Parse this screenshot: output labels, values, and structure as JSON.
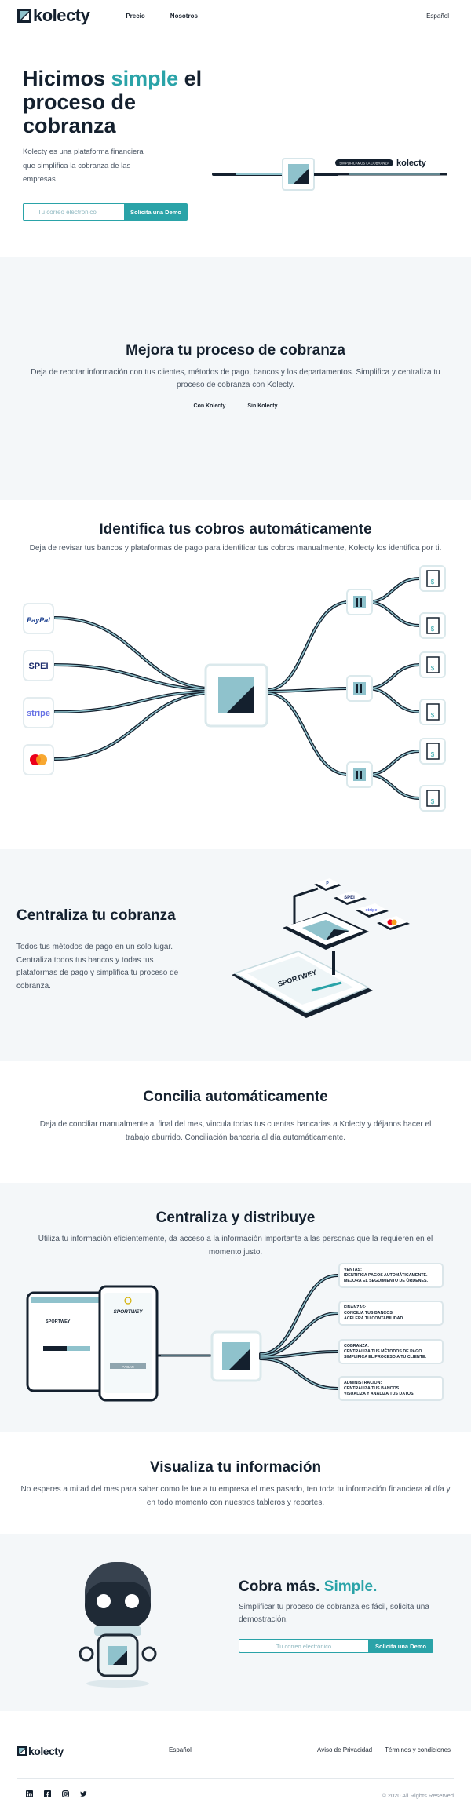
{
  "colors": {
    "accent": "#2aa3a8",
    "dark": "#14202e",
    "text": "#4a5563",
    "light_bg": "#f4f7f9"
  },
  "nav": {
    "brand": "kolecty",
    "links": [
      "Precio",
      "Nosotros"
    ],
    "language": "Español"
  },
  "hero": {
    "title_1": "Hicimos ",
    "title_accent": "simple",
    "title_2": " el proceso de cobranza",
    "description": "Kolecty es una plataforma financiera que simplifica la cobranza de las empresas.",
    "email_placeholder": "Tu correo electrónico",
    "demo_button": "Solicita una Demo",
    "badge": "SIMPLIFICAMOS LA COBRANZA",
    "badge_brand": "kolecty"
  },
  "mejora": {
    "title": "Mejora tu proceso de cobranza",
    "description": "Deja de rebotar información con tus clientes, métodos de pago, bancos y los departamentos. Simplifica y centraliza tu proceso de cobranza con Kolecty.",
    "tabs": [
      "Con Kolecty",
      "Sin Kolecty"
    ]
  },
  "identifica": {
    "title": "Identifica tus cobros automáticamente",
    "description": "Deja de revisar tus bancos y plataformas de pago para identificar tus cobros manualmente, Kolecty los identifica por ti.",
    "sources": [
      "PayPal",
      "SPEI",
      "stripe",
      "mastercard-icon"
    ]
  },
  "centraliza": {
    "title": "Centraliza tu cobranza",
    "description": "Todos tus métodos de pago en un solo lugar. Centraliza todos tus bancos y todas tus plataformas de pago y simplifica tu proceso de cobranza.",
    "phone_brand": "SPORTWEY"
  },
  "concilia": {
    "title": "Concilia automáticamente",
    "description": "Deja de conciliar manualmente al final del mes, vincula todas tus cuentas bancarias a Kolecty y déjanos hacer el trabajo aburrido. Conciliación bancaria al día automáticamente."
  },
  "distribuye": {
    "title": "Centraliza y distribuye",
    "description": "Utiliza tu información eficientemente, da acceso a la información importante a las personas que la requieren en el momento justo.",
    "laptop_brand": "SPORTWEY",
    "phone_brand": "SPORTWEY",
    "phone_button": "PAGAR",
    "cards": [
      {
        "l1": "VENTAS:",
        "l2": "IDENTIFICA PAGOS AUTOMÁTICAMENTE.",
        "l3": "MEJORA EL SEGUIMIENTO DE ÓRDENES."
      },
      {
        "l1": "FINANZAS:",
        "l2": "CONCILIA TUS BANCOS.",
        "l3": "ACELERA TU CONTABILIDAD."
      },
      {
        "l1": "COBRANZA:",
        "l2": "CENTRALIZA TUS MÉTODOS DE PAGO.",
        "l3": "SIMPLIFICA EL PROCESO A TU CLIENTE."
      },
      {
        "l1": "ADMINISTRACION:",
        "l2": "CENTRALIZA TUS BANCOS.",
        "l3": "VISUALIZA Y ANALIZA TUS DATOS."
      }
    ]
  },
  "visualiza": {
    "title": "Visualiza tu información",
    "description": "No esperes a mitad del mes para saber como le fue a tu empresa el mes pasado, ten toda tu información financiera al día y en todo momento con nuestros tableros y reportes."
  },
  "cobra": {
    "title_1": "Cobra más. ",
    "title_accent": "Simple.",
    "description": "Simplificar tu proceso de cobranza es fácil, solicita una demostración.",
    "email_placeholder": "Tu correo electrónico",
    "demo_button": "Solicita una Demo"
  },
  "footer": {
    "brand": "kolecty",
    "language": "Español",
    "privacy": "Aviso de Privacidad",
    "terms": "Términos y condiciones",
    "copyright": "© 2020 All Rights Reserved",
    "social": [
      "linkedin-icon",
      "facebook-icon",
      "instagram-icon",
      "twitter-icon"
    ]
  }
}
